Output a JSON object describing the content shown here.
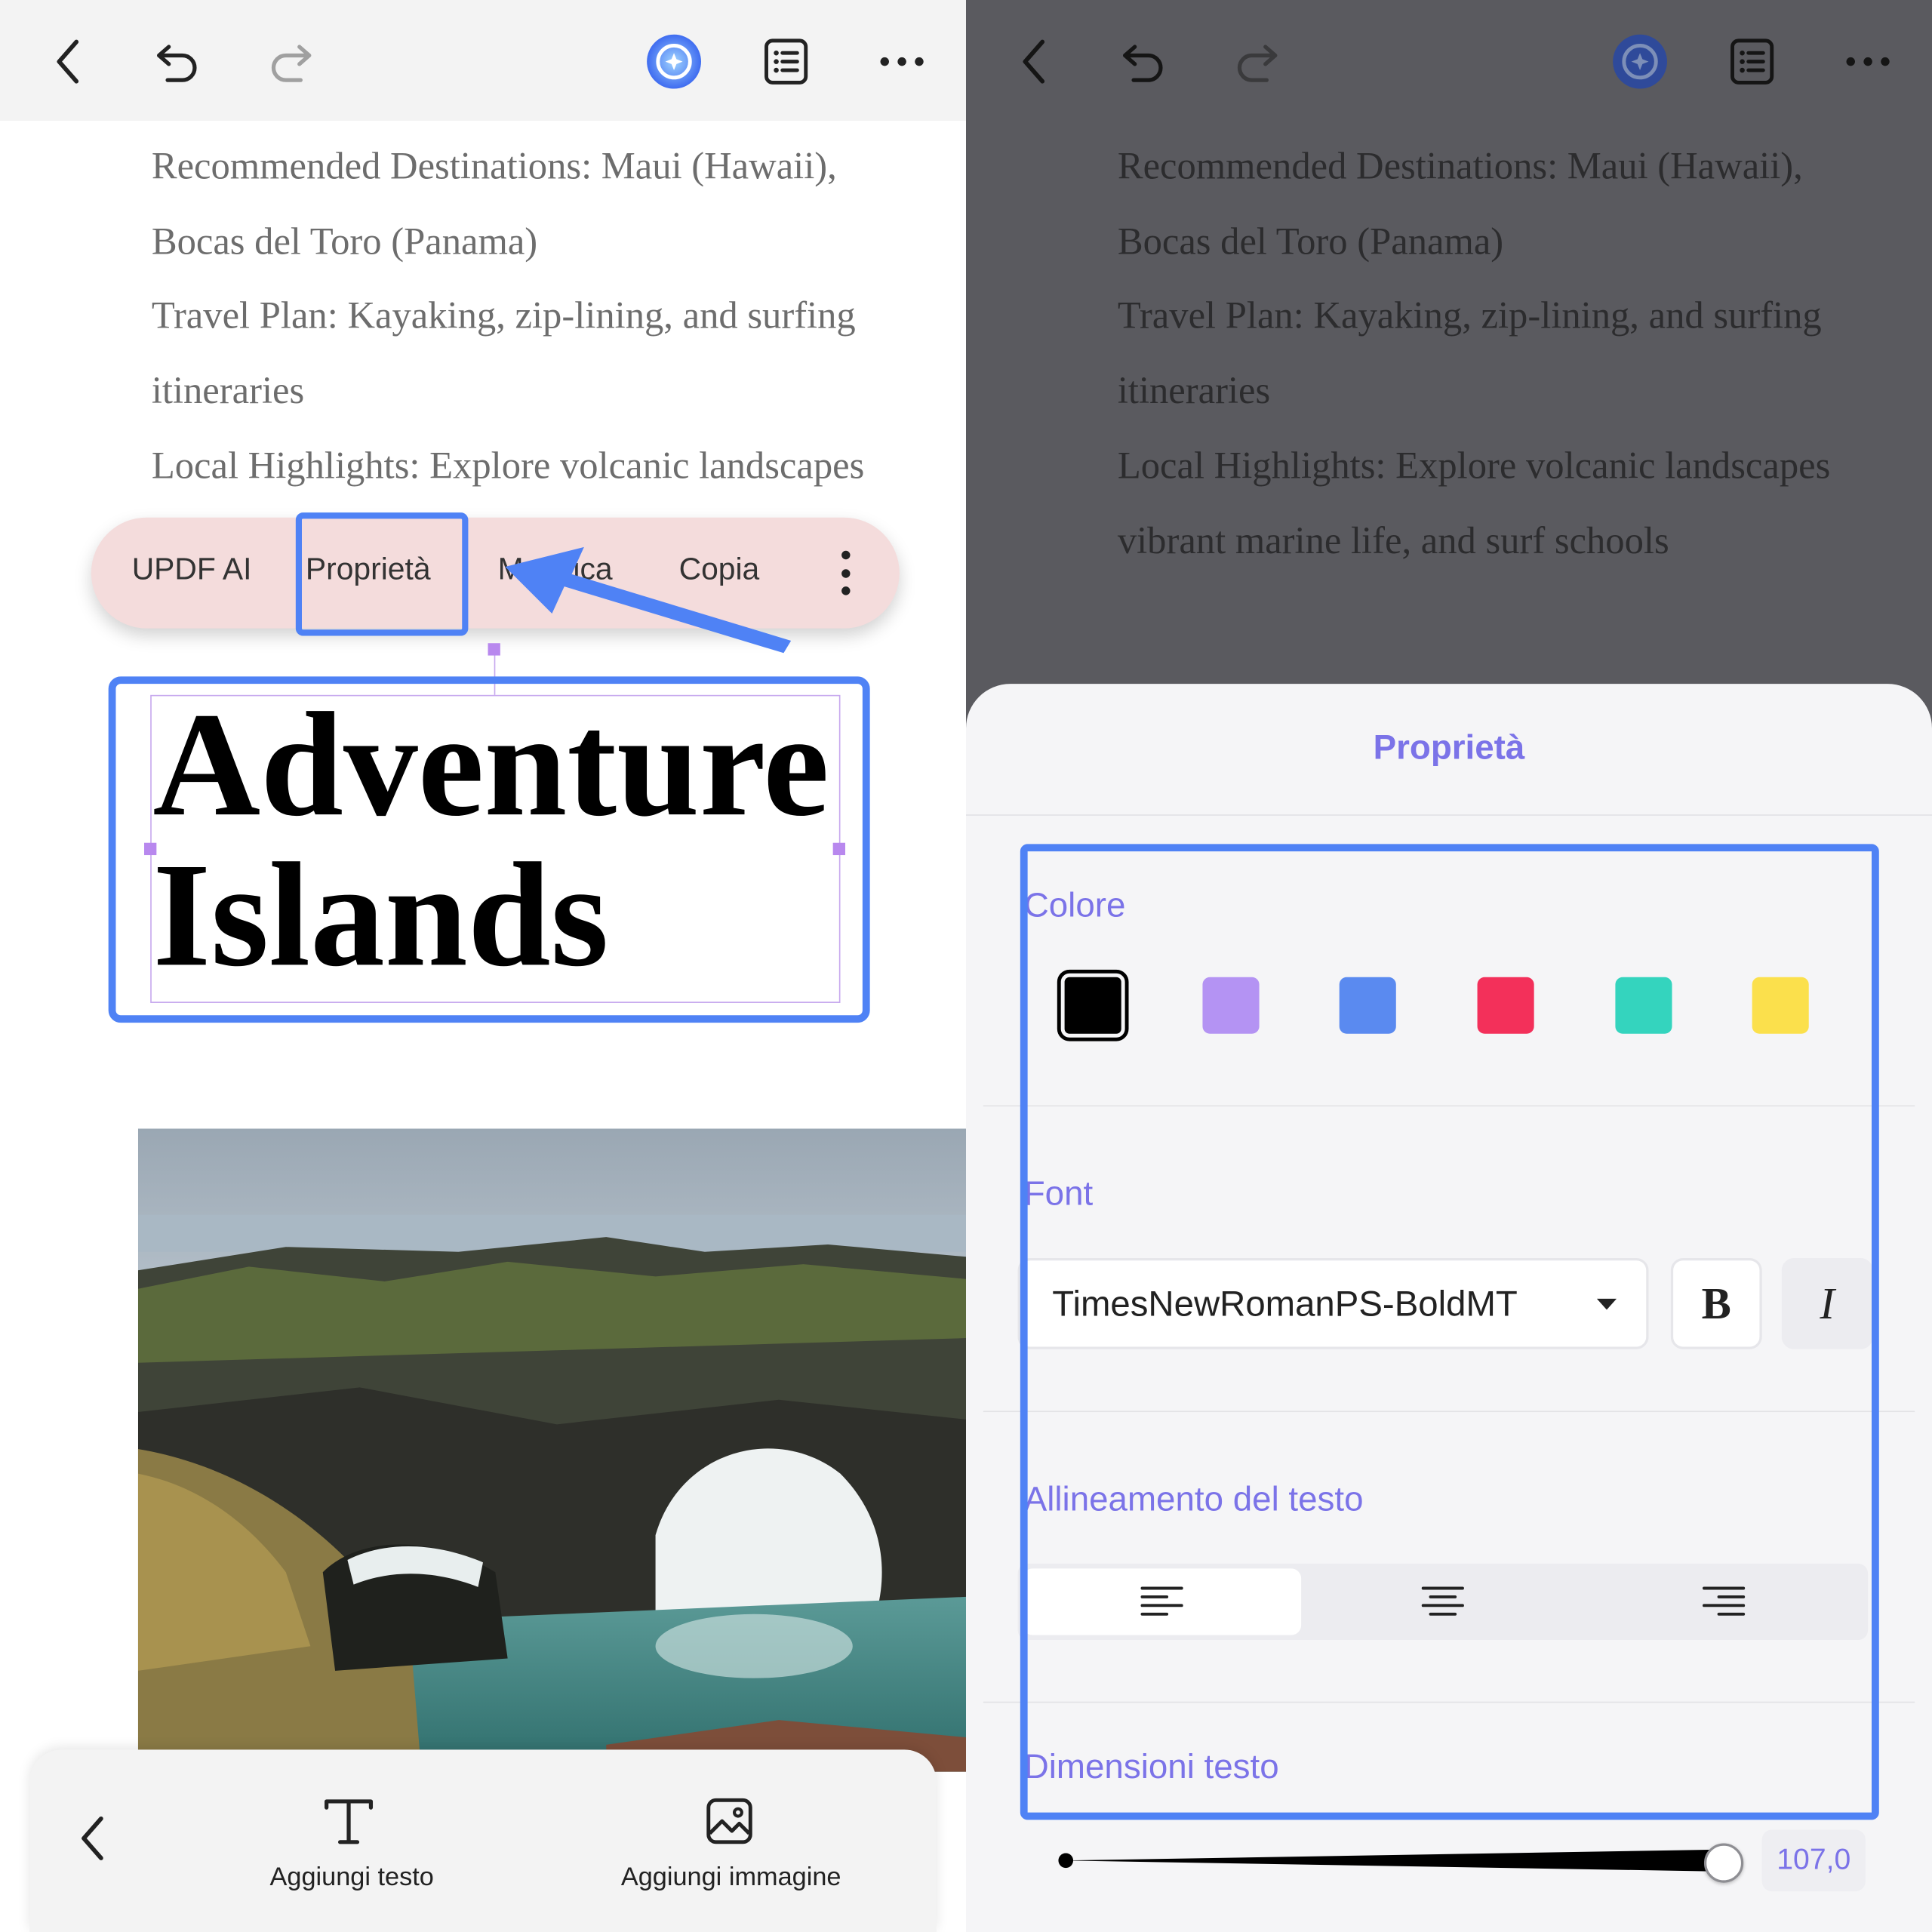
{
  "left": {
    "toolbar": {
      "back": "back",
      "undo": "undo",
      "redo": "redo",
      "ai": "updf-ai",
      "outline": "outline",
      "more": "more"
    },
    "doc_lines": [
      "Recommended Destinations: Maui (Hawaii),",
      "Bocas del Toro (Panama)",
      "Travel Plan: Kayaking, zip-lining, and surfing",
      "itineraries",
      "Local Highlights: Explore volcanic landscapes"
    ],
    "context_menu": {
      "updf_ai": "UPDF AI",
      "properties": "Proprietà",
      "edit": "Modifica",
      "copy": "Copia"
    },
    "title": {
      "line1": "Adventure",
      "line2": "Islands"
    },
    "bottom_bar": {
      "add_text": "Aggiungi testo",
      "add_image": "Aggiungi immagine"
    }
  },
  "right": {
    "doc_lines": [
      "Recommended Destinations: Maui (Hawaii),",
      "Bocas del Toro (Panama)",
      "Travel Plan: Kayaking, zip-lining, and surfing",
      "itineraries",
      "Local Highlights: Explore volcanic landscapes",
      "vibrant marine life, and surf schools"
    ],
    "sheet": {
      "title": "Proprietà",
      "color_label": "Colore",
      "colors": [
        "#000000",
        "#b493f3",
        "#5a8af0",
        "#f3305a",
        "#34d4be",
        "#fbe04c"
      ],
      "font_label": "Font",
      "font_name": "TimesNewRomanPS-BoldMT",
      "bold": "B",
      "italic": "I",
      "align_label": "Allineamento del testo",
      "size_label": "Dimensioni testo",
      "size_value": "107,0"
    }
  },
  "accent": "#4f82f5",
  "label_color": "#7b73e8"
}
